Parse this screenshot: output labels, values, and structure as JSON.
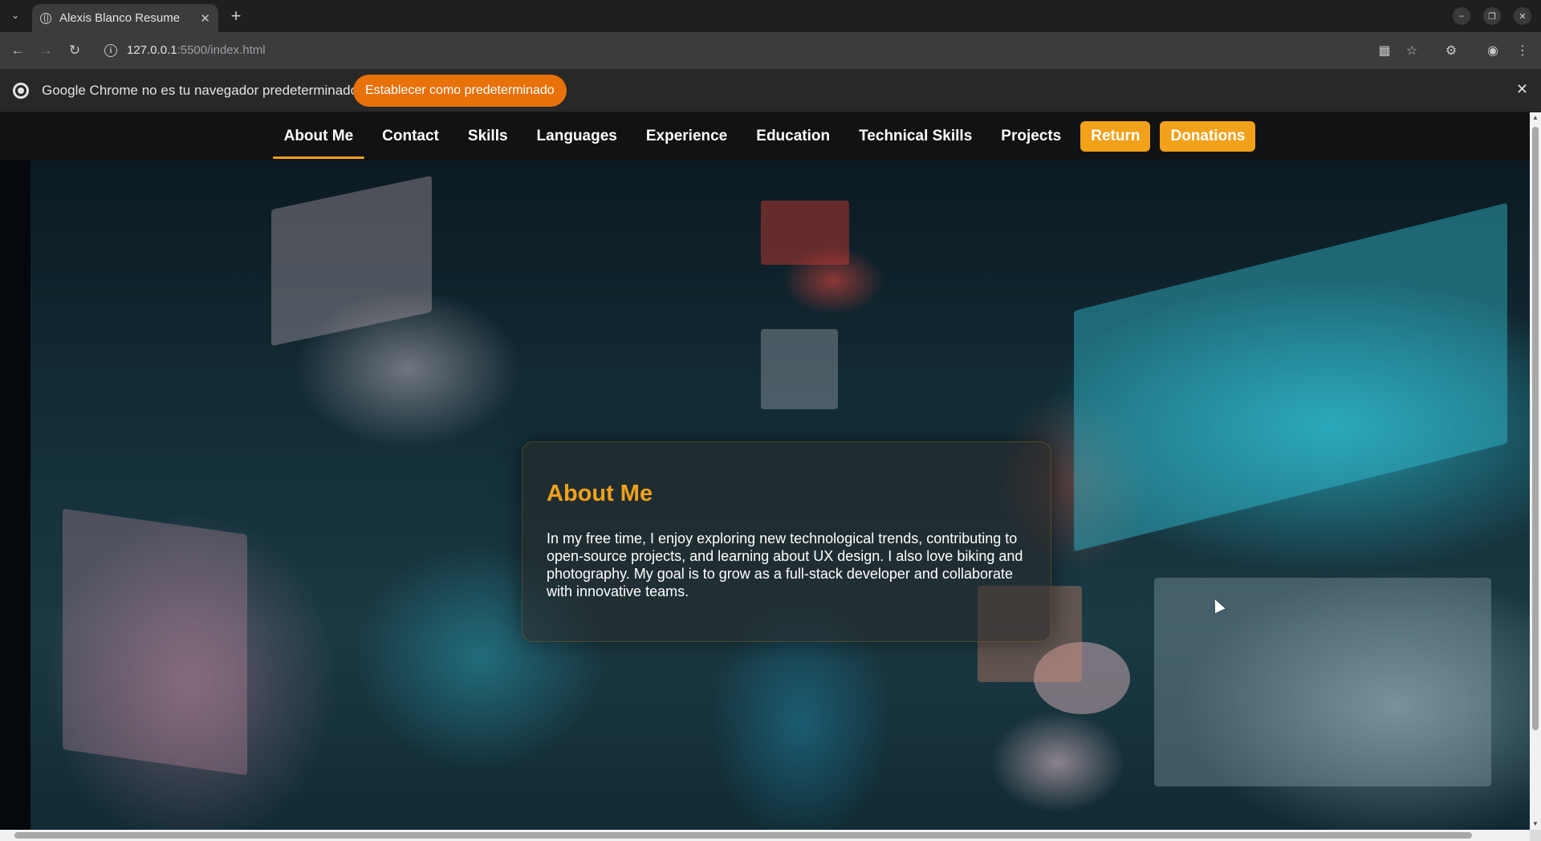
{
  "browser": {
    "tab_title": "Alexis Blanco Resume",
    "url_host": "127.0.0.1",
    "url_path": ":5500/index.html",
    "infobar_message": "Google Chrome no es tu navegador predeterminado",
    "infobar_button": "Establecer como predeterminado",
    "accent": "#e8710a"
  },
  "nav": {
    "links": [
      "About Me",
      "Contact",
      "Skills",
      "Languages",
      "Experience",
      "Education",
      "Technical Skills",
      "Projects"
    ],
    "buttons": [
      "Return",
      "Donations"
    ],
    "active": "About Me",
    "accent": "#f2a11b"
  },
  "about": {
    "title": "About Me",
    "text": "In my free time, I enjoy exploring new technological trends, contributing to open-source projects, and learning about UX design. I also love biking and photography. My goal is to grow as a full-stack developer and collaborate with innovative teams."
  }
}
